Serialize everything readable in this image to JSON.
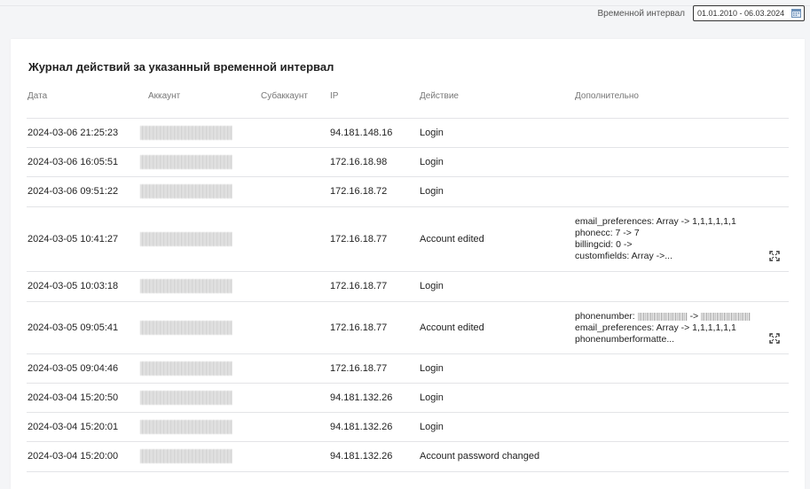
{
  "header": {
    "interval_label": "Временной интервал",
    "date_range_value": "01.01.2010 - 06.03.2024"
  },
  "log": {
    "title": "Журнал действий за указанный временной интервал",
    "columns": [
      "Дата",
      "Аккаунт",
      "Субаккаунт",
      "IP",
      "Действие",
      "Дополнительно"
    ],
    "rows": [
      {
        "date": "2024-03-06 21:25:23",
        "ip": "94.181.148.16",
        "action": "Login"
      },
      {
        "date": "2024-03-06 16:05:51",
        "ip": "172.16.18.98",
        "action": "Login"
      },
      {
        "date": "2024-03-06 09:51:22",
        "ip": "172.16.18.72",
        "action": "Login"
      },
      {
        "date": "2024-03-05 10:41:27",
        "ip": "172.16.18.77",
        "action": "Account edited",
        "extra": [
          "email_preferences: Array -> 1,1,1,1,1,1",
          "phonecc: 7 -> 7",
          "billingcid: 0 ->",
          "customfields: Array ->..."
        ]
      },
      {
        "date": "2024-03-05 10:03:18",
        "ip": "172.16.18.77",
        "action": "Login"
      },
      {
        "date": "2024-03-05 09:05:41",
        "ip": "172.16.18.77",
        "action": "Account edited",
        "extra": [
          "phonenumber:",
          "email_preferences: Array -> 1,1,1,1,1,1",
          "phonenumberformatte..."
        ],
        "extra_arrow": "->"
      },
      {
        "date": "2024-03-05 09:04:46",
        "ip": "172.16.18.77",
        "action": "Login"
      },
      {
        "date": "2024-03-04 15:20:50",
        "ip": "94.181.132.26",
        "action": "Login"
      },
      {
        "date": "2024-03-04 15:20:01",
        "ip": "94.181.132.26",
        "action": "Login"
      },
      {
        "date": "2024-03-04 15:20:00",
        "ip": "94.181.132.26",
        "action": "Account password changed"
      }
    ]
  },
  "icons": {
    "calendar": "calendar-icon",
    "expand": "expand-icon"
  }
}
